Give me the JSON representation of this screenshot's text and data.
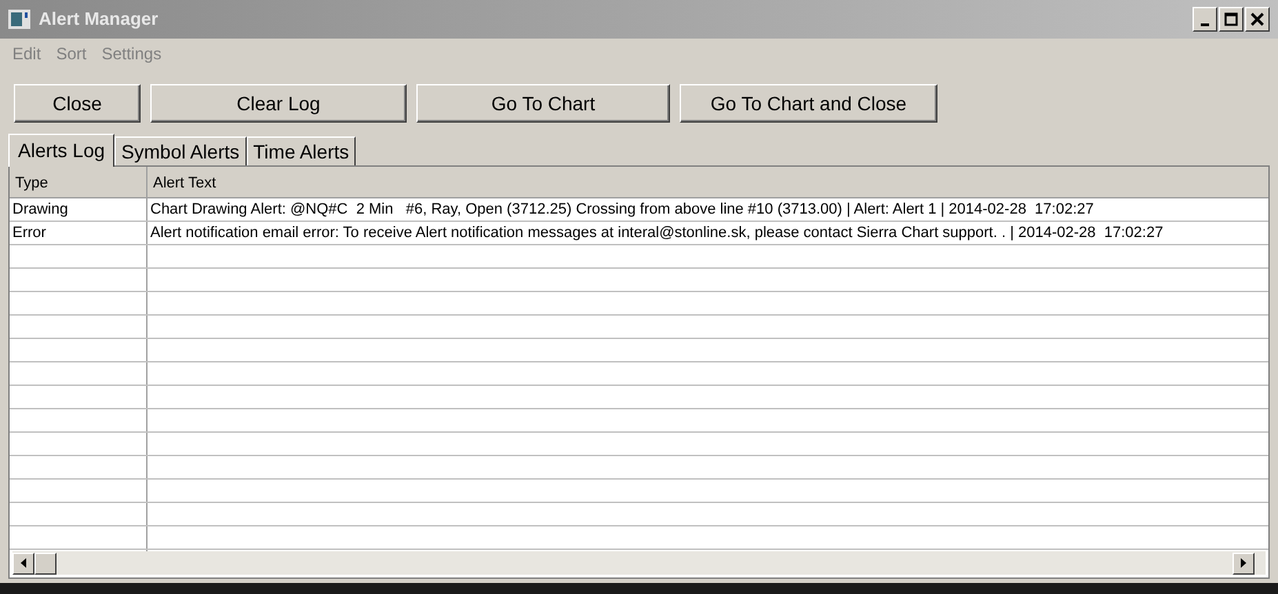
{
  "window": {
    "title": "Alert Manager"
  },
  "menu": [
    "Edit",
    "Sort",
    "Settings"
  ],
  "buttons": [
    "Close",
    "Clear Log",
    "Go To Chart",
    "Go To Chart and Close"
  ],
  "tabs": [
    {
      "label": "Alerts Log",
      "selected": true
    },
    {
      "label": "Symbol Alerts",
      "selected": false
    },
    {
      "label": "Time Alerts",
      "selected": false
    }
  ],
  "table": {
    "columns": [
      "Type",
      "Alert Text"
    ],
    "rows": [
      [
        "Drawing",
        "Chart Drawing Alert: @NQ#C  2 Min   #6, Ray, Open (3712.25) Crossing from above line #10 (3713.00) | Alert: Alert 1 | 2014-02-28  17:02:27"
      ],
      [
        "Error",
        "Alert notification email error: To receive Alert notification messages at interal@stonline.sk, please contact Sierra Chart support. . | 2014-02-28  17:02:27"
      ]
    ]
  }
}
